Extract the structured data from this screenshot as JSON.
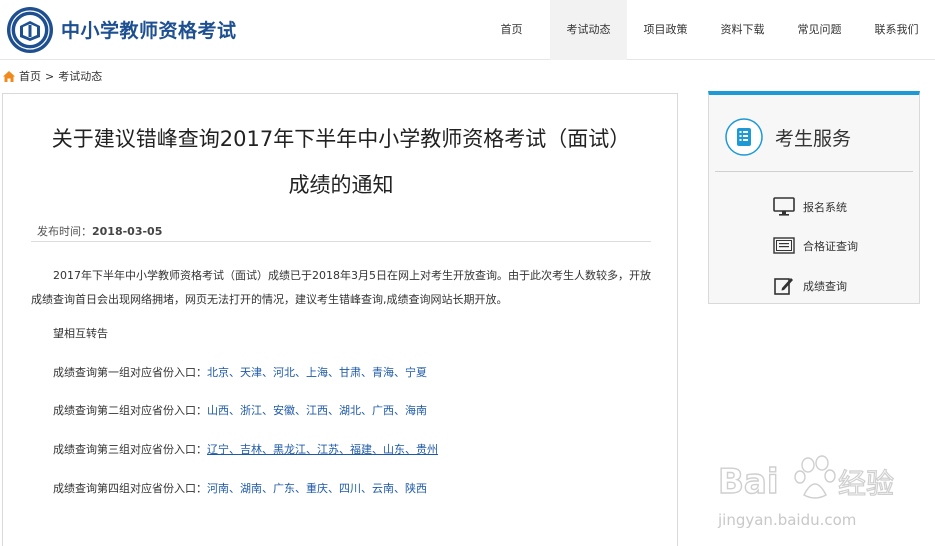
{
  "site": {
    "title": "中小学教师资格考试",
    "logo_icon": "exam-seal-logo",
    "brand_color": "#1d4f91"
  },
  "nav": {
    "items": [
      {
        "label": "首页"
      },
      {
        "label": "考试动态"
      },
      {
        "label": "项目政策"
      },
      {
        "label": "资料下载"
      },
      {
        "label": "常见问题"
      },
      {
        "label": "联系我们"
      }
    ],
    "active_index": 1
  },
  "breadcrumb": {
    "home_icon": "home-icon",
    "home": "首页",
    "separator": ">",
    "current": "考试动态"
  },
  "article": {
    "title_line1": "关于建议错峰查询2017年下半年中小学教师资格考试（面试）",
    "title_line2": "成绩的通知",
    "published_label": "发布时间：",
    "published_date": "2018-03-05",
    "paragraph": "2017年下半年中小学教师资格考试（面试）成绩已于2018年3月5日在网上对考生开放查询。由于此次考生人数较多，开放成绩查询首日会出现网络拥堵，网页无法打开的情况，建议考生错峰查询,成绩查询网站长期开放。",
    "notice": "望相互转告",
    "groups": [
      {
        "label": "成绩查询第一组对应省份入口：",
        "provinces": "北京、天津、河北、上海、甘肃、青海、宁夏"
      },
      {
        "label": "成绩查询第二组对应省份入口：",
        "provinces": "山西、浙江、安徽、江西、湖北、广西、海南"
      },
      {
        "label": "成绩查询第三组对应省份入口：",
        "provinces": "辽宁、吉林、黑龙江、江苏、福建、山东、贵州"
      },
      {
        "label": "成绩查询第四组对应省份入口：",
        "provinces": "河南、湖南、广东、重庆、四川、云南、陕西"
      }
    ],
    "link_color": "#1e5aa8"
  },
  "sidebar": {
    "title": "考生服务",
    "accent": "#1d9ad6",
    "items": [
      {
        "label": "报名系统",
        "icon": "monitor-icon"
      },
      {
        "label": "合格证查询",
        "icon": "certificate-icon"
      },
      {
        "label": "成绩查询",
        "icon": "edit-icon"
      }
    ]
  },
  "watermark": {
    "brand": "Bai",
    "brand_tail": "经验",
    "url": "jingyan.baidu.com"
  }
}
